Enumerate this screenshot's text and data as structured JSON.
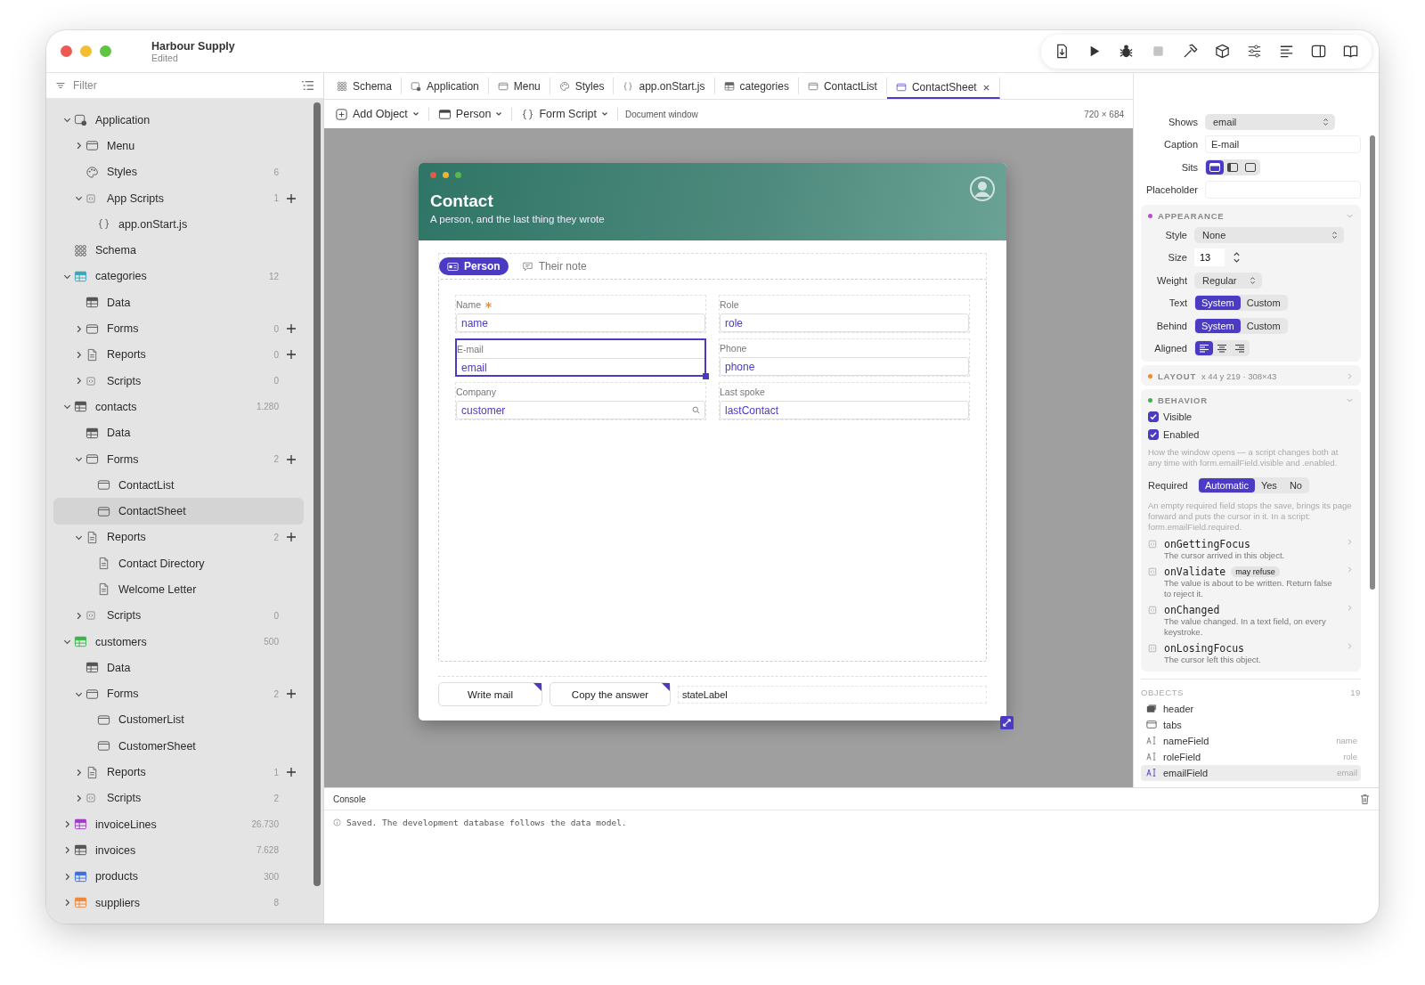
{
  "window": {
    "title": "Harbour Supply",
    "subtitle": "Edited"
  },
  "toolbar": [
    {
      "kind": "export",
      "disabled": false
    },
    {
      "kind": "run",
      "disabled": false
    },
    {
      "kind": "debug",
      "disabled": false
    },
    {
      "kind": "stop",
      "disabled": true
    },
    {
      "kind": "build",
      "disabled": false
    },
    {
      "kind": "package",
      "disabled": false
    },
    {
      "kind": "settings",
      "disabled": false
    },
    {
      "kind": "outline",
      "disabled": false
    },
    {
      "kind": "inspector",
      "disabled": false
    },
    {
      "kind": "docs",
      "disabled": false
    }
  ],
  "sidebar": {
    "filter_placeholder": "Filter",
    "tree": [
      {
        "label": "Application",
        "kind": "app",
        "expanded": true,
        "selected": false,
        "children": [
          {
            "label": "Menu",
            "kind": "window",
            "expanded": false,
            "selected": false
          },
          {
            "label": "Styles",
            "kind": "palette",
            "count": "6",
            "selected": false
          },
          {
            "label": "App Scripts",
            "kind": "script",
            "expanded": true,
            "count": "1",
            "add": true,
            "selected": false,
            "children": [
              {
                "label": "app.onStart.js",
                "kind": "braces",
                "selected": false
              }
            ]
          }
        ]
      },
      {
        "label": "Schema",
        "kind": "schema",
        "selected": false
      },
      {
        "label": "categories",
        "kind": "table",
        "color": "#3aa8b8",
        "expanded": true,
        "count": "12",
        "selected": false,
        "children": [
          {
            "label": "Data",
            "kind": "table",
            "selected": false
          },
          {
            "label": "Forms",
            "kind": "window",
            "expanded": false,
            "count": "0",
            "add": true,
            "selected": false
          },
          {
            "label": "Reports",
            "kind": "report",
            "expanded": false,
            "count": "0",
            "add": true,
            "selected": false
          },
          {
            "label": "Scripts",
            "kind": "script",
            "expanded": false,
            "count": "0",
            "selected": false
          }
        ]
      },
      {
        "label": "contacts",
        "kind": "table",
        "color": "#555555",
        "expanded": true,
        "count": "1.280",
        "selected": false,
        "children": [
          {
            "label": "Data",
            "kind": "table",
            "selected": false
          },
          {
            "label": "Forms",
            "kind": "window",
            "expanded": true,
            "count": "2",
            "add": true,
            "selected": false,
            "children": [
              {
                "label": "ContactList",
                "kind": "window",
                "selected": false
              },
              {
                "label": "ContactSheet",
                "kind": "window",
                "selected": true
              }
            ]
          },
          {
            "label": "Reports",
            "kind": "report",
            "expanded": true,
            "count": "2",
            "add": true,
            "selected": false,
            "children": [
              {
                "label": "Contact Directory",
                "kind": "report",
                "selected": false
              },
              {
                "label": "Welcome Letter",
                "kind": "report",
                "selected": false
              }
            ]
          },
          {
            "label": "Scripts",
            "kind": "script",
            "expanded": false,
            "count": "0",
            "selected": false
          }
        ]
      },
      {
        "label": "customers",
        "kind": "table",
        "color": "#3cb44a",
        "expanded": true,
        "count": "500",
        "selected": false,
        "children": [
          {
            "label": "Data",
            "kind": "table",
            "selected": false
          },
          {
            "label": "Forms",
            "kind": "window",
            "expanded": true,
            "count": "2",
            "add": true,
            "selected": false,
            "children": [
              {
                "label": "CustomerList",
                "kind": "window",
                "selected": false
              },
              {
                "label": "CustomerSheet",
                "kind": "window",
                "selected": false
              }
            ]
          },
          {
            "label": "Reports",
            "kind": "report",
            "expanded": false,
            "count": "1",
            "add": true,
            "selected": false
          },
          {
            "label": "Scripts",
            "kind": "script",
            "expanded": false,
            "count": "2",
            "selected": false
          }
        ]
      },
      {
        "label": "invoiceLines",
        "kind": "table",
        "color": "#a03cc8",
        "expanded": false,
        "count": "26.730",
        "selected": false
      },
      {
        "label": "invoices",
        "kind": "table",
        "color": "#555555",
        "expanded": false,
        "count": "7.628",
        "selected": false
      },
      {
        "label": "products",
        "kind": "table",
        "color": "#3d6fe0",
        "expanded": false,
        "count": "300",
        "selected": false
      },
      {
        "label": "suppliers",
        "kind": "table",
        "color": "#ee8a3a",
        "expanded": false,
        "count": "8",
        "selected": false
      }
    ]
  },
  "editor_tabs": [
    {
      "label": "Schema",
      "kind": "schema",
      "selected": false
    },
    {
      "label": "Application",
      "kind": "app",
      "selected": false
    },
    {
      "label": "Menu",
      "kind": "window",
      "selected": false
    },
    {
      "label": "Styles",
      "kind": "palette",
      "selected": false
    },
    {
      "label": "app.onStart.js",
      "kind": "braces",
      "selected": false
    },
    {
      "label": "categories",
      "kind": "table",
      "selected": false
    },
    {
      "label": "ContactList",
      "kind": "window",
      "selected": false
    },
    {
      "label": "ContactSheet",
      "kind": "window",
      "selected": true
    }
  ],
  "form_toolbar": {
    "add_object": "Add Object",
    "form": "Person",
    "script": "Form Script",
    "mode": "Document window",
    "size": "720 × 684"
  },
  "design": {
    "title": "Contact",
    "subtitle": "A person, and the last thing they wrote",
    "tabs": [
      {
        "label": "Person",
        "selected": true
      },
      {
        "label": "Their note",
        "selected": false
      }
    ],
    "fields": [
      {
        "label": "Name",
        "binding": "name",
        "required": true,
        "lookup": false,
        "selected": false
      },
      {
        "label": "Role",
        "binding": "role",
        "required": false,
        "lookup": false,
        "selected": false
      },
      {
        "label": "E-mail",
        "binding": "email",
        "required": false,
        "lookup": false,
        "selected": true
      },
      {
        "label": "Phone",
        "binding": "phone",
        "required": false,
        "lookup": false,
        "selected": false
      },
      {
        "label": "Company",
        "binding": "customer",
        "required": false,
        "lookup": true,
        "selected": false
      },
      {
        "label": "Last spoke",
        "binding": "lastContact",
        "required": false,
        "lookup": false,
        "selected": false
      }
    ],
    "buttons": [
      {
        "label": "Write mail"
      },
      {
        "label": "Copy the answer"
      }
    ],
    "state_label": "stateLabel"
  },
  "inspector": {
    "properties": [
      {
        "label": "Shows",
        "kind": "select",
        "value": "email"
      },
      {
        "label": "Caption",
        "kind": "text",
        "value": "E-mail"
      },
      {
        "label": "Sits",
        "kind": "placement",
        "options": [
          {
            "selected": true
          },
          {
            "selected": false
          },
          {
            "selected": false
          }
        ]
      },
      {
        "label": "Placeholder",
        "kind": "text"
      }
    ],
    "sections": [
      {
        "title": "APPEARANCE",
        "color": "#b44fd6",
        "expanded": true,
        "rows": [
          {
            "label": "Style",
            "kind": "select",
            "value": "None"
          },
          {
            "label": "Size",
            "kind": "stepper",
            "value": "13"
          },
          {
            "label": "Weight",
            "kind": "select",
            "value": "Regular"
          },
          {
            "label": "Text",
            "kind": "segments",
            "options": [
              {
                "label": "System",
                "selected": true
              },
              {
                "label": "Custom",
                "selected": false
              }
            ]
          },
          {
            "label": "Behind",
            "kind": "segments",
            "options": [
              {
                "label": "System",
                "selected": true
              },
              {
                "label": "Custom",
                "selected": false
              }
            ]
          },
          {
            "label": "Aligned",
            "kind": "alignment",
            "options": [
              {
                "selected": true
              },
              {
                "selected": false
              },
              {
                "selected": false
              }
            ]
          }
        ]
      },
      {
        "title": "LAYOUT",
        "color": "#f08a2c",
        "expanded": false,
        "summary": "x 44 y 219 · 308×43"
      },
      {
        "title": "BEHAVIOR",
        "color": "#3cb44a",
        "expanded": true,
        "rows": [
          {
            "kind": "checkbox",
            "label": "Visible",
            "checked": true
          },
          {
            "kind": "checkbox",
            "label": "Enabled",
            "checked": true
          },
          {
            "kind": "note",
            "text": "How the window opens — a script changes both at any time with form.emailField.visible and .enabled."
          },
          {
            "kind": "segments",
            "label": "Required",
            "options": [
              {
                "label": "Automatic",
                "selected": true
              },
              {
                "label": "Yes",
                "selected": false
              },
              {
                "label": "No",
                "selected": false
              }
            ]
          },
          {
            "kind": "note",
            "text": "An empty required field stops the save, brings its page forward and puts the cursor in it. In a script: form.emailField.required."
          },
          {
            "kind": "event",
            "name": "onGettingFocus",
            "text": "The cursor arrived in this object."
          },
          {
            "kind": "event",
            "name": "onValidate",
            "badge": "may refuse",
            "text": "The value is about to be written. Return false to reject it."
          },
          {
            "kind": "event",
            "name": "onChanged",
            "text": "The value changed. In a text field, on every keystroke."
          },
          {
            "kind": "event",
            "name": "onLosingFocus",
            "text": "The cursor left this object."
          }
        ]
      }
    ],
    "objects": {
      "title": "OBJECTS",
      "count": "19",
      "items": [
        {
          "name": "header",
          "kind": "header",
          "selected": false
        },
        {
          "name": "tabs",
          "kind": "tabs",
          "selected": false
        },
        {
          "name": "nameField",
          "kind": "field",
          "binding": "name",
          "selected": false
        },
        {
          "name": "roleField",
          "kind": "field",
          "binding": "role",
          "selected": false
        },
        {
          "name": "emailField",
          "kind": "field",
          "binding": "email",
          "selected": true
        }
      ]
    }
  },
  "console": {
    "title": "Console",
    "messages": [
      {
        "text": "Saved. The development database follows the data model."
      }
    ]
  }
}
